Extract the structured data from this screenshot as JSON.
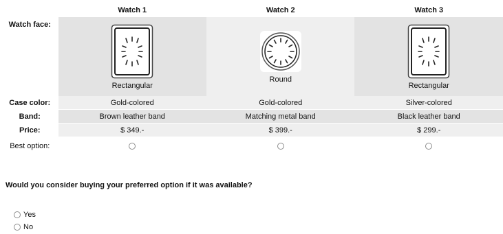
{
  "table": {
    "columns": [
      "Watch 1",
      "Watch 2",
      "Watch 3"
    ],
    "rows": {
      "watch_face": {
        "label": "Watch face:",
        "values": [
          "Rectangular",
          "Round",
          "Rectangular"
        ],
        "icons": [
          "rectangular-watch-face-icon",
          "round-watch-face-icon",
          "rectangular-watch-face-icon"
        ]
      },
      "case_color": {
        "label": "Case color:",
        "values": [
          "Gold-colored",
          "Gold-colored",
          "Silver-colored"
        ]
      },
      "band": {
        "label": "Band:",
        "values": [
          "Brown leather band",
          "Matching metal band",
          "Black leather band"
        ]
      },
      "price": {
        "label": "Price:",
        "values": [
          "$ 349.-",
          "$ 399.-",
          "$ 299.-"
        ]
      },
      "best_option": {
        "label": "Best option:"
      }
    }
  },
  "question": {
    "text": "Would you consider buying your preferred option if it was available?",
    "options": [
      "Yes",
      "No"
    ]
  },
  "colors": {
    "cell_dark": "#e3e3e3",
    "cell_light": "#efefef",
    "radio_border": "#8c8c8c"
  }
}
